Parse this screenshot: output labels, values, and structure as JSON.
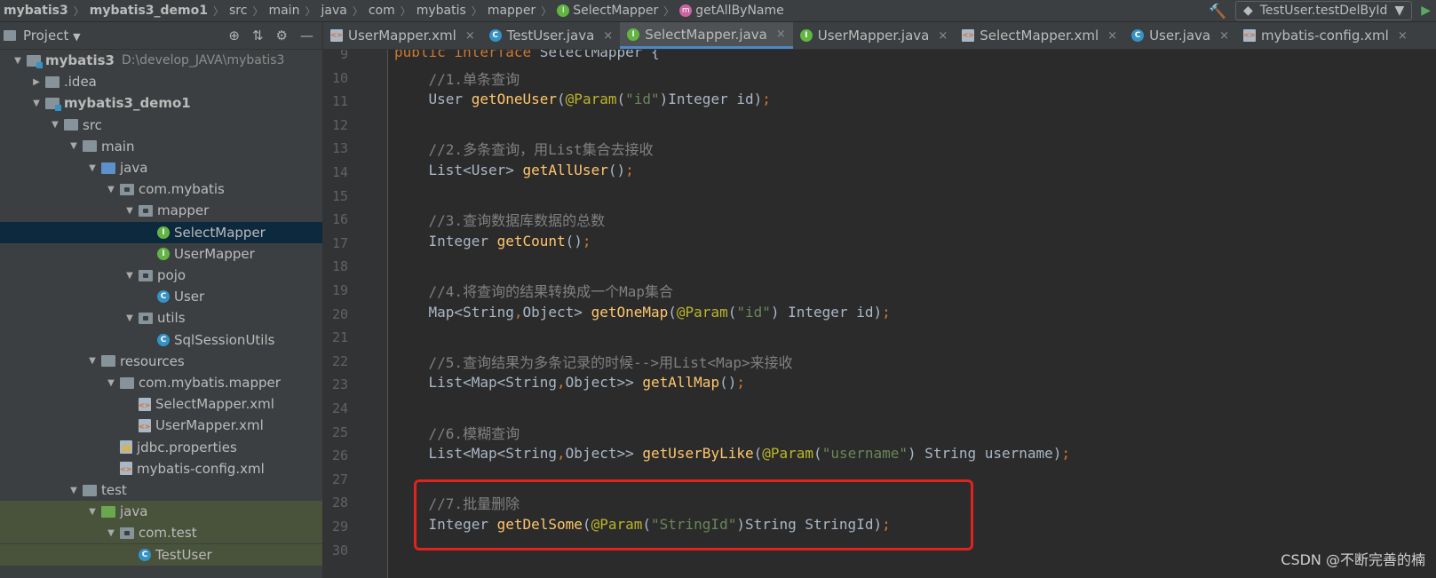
{
  "breadcrumb": [
    "mybatis3",
    "mybatis3_demo1",
    "src",
    "main",
    "java",
    "com",
    "mybatis",
    "mapper",
    "SelectMapper",
    "getAllByName"
  ],
  "run_config": {
    "label": "TestUser.testDelById"
  },
  "project_panel": {
    "title": "Project",
    "tree": [
      {
        "label": "mybatis3",
        "hint": "D:\\develop_JAVA\\mybatis3",
        "icon": "module",
        "depth": 0,
        "open": true,
        "bold": true
      },
      {
        "label": ".idea",
        "icon": "folder",
        "depth": 1,
        "open": false
      },
      {
        "label": "mybatis3_demo1",
        "icon": "module",
        "depth": 1,
        "open": true,
        "bold": true
      },
      {
        "label": "src",
        "icon": "folder",
        "depth": 2,
        "open": true
      },
      {
        "label": "main",
        "icon": "folder",
        "depth": 3,
        "open": true
      },
      {
        "label": "java",
        "icon": "folder-blue",
        "depth": 4,
        "open": true
      },
      {
        "label": "com.mybatis",
        "icon": "package",
        "depth": 5,
        "open": true
      },
      {
        "label": "mapper",
        "icon": "package",
        "depth": 6,
        "open": true
      },
      {
        "label": "SelectMapper",
        "icon": "interface",
        "depth": 7,
        "selected": true
      },
      {
        "label": "UserMapper",
        "icon": "interface",
        "depth": 7
      },
      {
        "label": "pojo",
        "icon": "package",
        "depth": 6,
        "open": true
      },
      {
        "label": "User",
        "icon": "class",
        "depth": 7
      },
      {
        "label": "utils",
        "icon": "package",
        "depth": 6,
        "open": true
      },
      {
        "label": "SqlSessionUtils",
        "icon": "class",
        "depth": 7
      },
      {
        "label": "resources",
        "icon": "folder-res",
        "depth": 4,
        "open": true
      },
      {
        "label": "com.mybatis.mapper",
        "icon": "folder",
        "depth": 5,
        "open": true
      },
      {
        "label": "SelectMapper.xml",
        "icon": "xml",
        "depth": 6
      },
      {
        "label": "UserMapper.xml",
        "icon": "xml",
        "depth": 6
      },
      {
        "label": "jdbc.properties",
        "icon": "properties",
        "depth": 5
      },
      {
        "label": "mybatis-config.xml",
        "icon": "xml",
        "depth": 5
      },
      {
        "label": "test",
        "icon": "folder",
        "depth": 3,
        "open": true
      },
      {
        "label": "java",
        "icon": "folder-green",
        "depth": 4,
        "open": true,
        "test": true
      },
      {
        "label": "com.test",
        "icon": "package",
        "depth": 5,
        "open": true,
        "test": true
      },
      {
        "label": "TestUser",
        "icon": "class",
        "depth": 6,
        "test": true
      }
    ]
  },
  "tabs": [
    {
      "label": "UserMapper.xml",
      "icon": "xml"
    },
    {
      "label": "TestUser.java",
      "icon": "class"
    },
    {
      "label": "SelectMapper.java",
      "icon": "interface",
      "active": true
    },
    {
      "label": "UserMapper.java",
      "icon": "interface"
    },
    {
      "label": "SelectMapper.xml",
      "icon": "xml"
    },
    {
      "label": "User.java",
      "icon": "class"
    },
    {
      "label": "mybatis-config.xml",
      "icon": "xml"
    }
  ],
  "code_lines": [
    {
      "n": "9",
      "t": [
        [
          "kw",
          "public interface "
        ],
        [
          "",
          "SelectMapper {"
        ]
      ]
    },
    {
      "n": "10",
      "t": [
        [
          "cm",
          "    //1.单条查询"
        ]
      ]
    },
    {
      "n": "11",
      "t": [
        [
          "",
          "    User "
        ],
        [
          "fn",
          "getOneUser"
        ],
        [
          "",
          "("
        ],
        [
          "an",
          "@Param"
        ],
        [
          "",
          "("
        ],
        [
          "st",
          "\"id\""
        ],
        [
          "",
          ")Integer id)"
        ],
        [
          "pu",
          ";"
        ]
      ]
    },
    {
      "n": "12",
      "t": []
    },
    {
      "n": "13",
      "t": [
        [
          "cm",
          "    //2.多条查询，用List集合去接收"
        ]
      ]
    },
    {
      "n": "14",
      "t": [
        [
          "",
          "    List<User> "
        ],
        [
          "fn",
          "getAllUser"
        ],
        [
          "",
          "()"
        ],
        [
          "pu",
          ";"
        ]
      ]
    },
    {
      "n": "15",
      "t": []
    },
    {
      "n": "16",
      "t": [
        [
          "cm",
          "    //3.查询数据库数据的总数"
        ]
      ]
    },
    {
      "n": "17",
      "t": [
        [
          "",
          "    Integer "
        ],
        [
          "fn",
          "getCount"
        ],
        [
          "",
          "()"
        ],
        [
          "pu",
          ";"
        ]
      ]
    },
    {
      "n": "18",
      "t": []
    },
    {
      "n": "19",
      "t": [
        [
          "cm",
          "    //4.将查询的结果转换成一个Map集合"
        ]
      ]
    },
    {
      "n": "20",
      "t": [
        [
          "",
          "    Map<String"
        ],
        [
          "pu",
          ","
        ],
        [
          "",
          "Object> "
        ],
        [
          "fn",
          "getOneMap"
        ],
        [
          "",
          "("
        ],
        [
          "an",
          "@Param"
        ],
        [
          "",
          "("
        ],
        [
          "st",
          "\"id\""
        ],
        [
          "",
          ") Integer id)"
        ],
        [
          "pu",
          ";"
        ]
      ]
    },
    {
      "n": "21",
      "t": []
    },
    {
      "n": "22",
      "t": [
        [
          "cm",
          "    //5.查询结果为多条记录的时候-->用List<Map>来接收"
        ]
      ]
    },
    {
      "n": "23",
      "t": [
        [
          "",
          "    List<Map<String"
        ],
        [
          "pu",
          ","
        ],
        [
          "",
          "Object>> "
        ],
        [
          "fn",
          "getAllMap"
        ],
        [
          "",
          "()"
        ],
        [
          "pu",
          ";"
        ]
      ]
    },
    {
      "n": "24",
      "t": []
    },
    {
      "n": "25",
      "t": [
        [
          "cm",
          "    //6.模糊查询"
        ]
      ]
    },
    {
      "n": "26",
      "t": [
        [
          "",
          "    List<Map<String"
        ],
        [
          "pu",
          ","
        ],
        [
          "",
          "Object>> "
        ],
        [
          "fn",
          "getUserByLike"
        ],
        [
          "",
          "("
        ],
        [
          "an",
          "@Param"
        ],
        [
          "",
          "("
        ],
        [
          "st",
          "\"username\""
        ],
        [
          "",
          ") String username)"
        ],
        [
          "pu",
          ";"
        ]
      ]
    },
    {
      "n": "27",
      "t": []
    },
    {
      "n": "28",
      "t": [
        [
          "cm",
          "    //7.批量删除"
        ]
      ]
    },
    {
      "n": "29",
      "t": [
        [
          "",
          "    Integer "
        ],
        [
          "fn",
          "getDelSome"
        ],
        [
          "",
          "("
        ],
        [
          "an",
          "@Param"
        ],
        [
          "",
          "("
        ],
        [
          "st",
          "\"StringId\""
        ],
        [
          "",
          ")String StringId)"
        ],
        [
          "pu",
          ";"
        ]
      ]
    },
    {
      "n": "30",
      "t": []
    }
  ],
  "watermark": "CSDN @不断完善的楠",
  "colors": {
    "accent": "#4a88c7",
    "highlight_box": "#e0231e",
    "keyword": "#cc7832",
    "method": "#ffc66d",
    "annotation": "#bbb529",
    "string": "#6a8759",
    "comment": "#808080"
  }
}
